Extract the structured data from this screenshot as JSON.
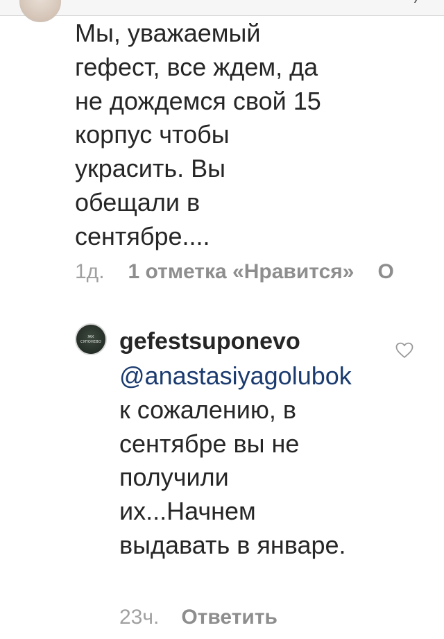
{
  "top_comment": {
    "text": "Мы, уважаемый\nгефест, все ждем, да\nне дождемся свой 15\nкорпус чтобы\nукрасить. Вы\nобещали в\nсентябре....",
    "time": "1д.",
    "likes": "1 отметка «Нравится»",
    "reply_label": "О"
  },
  "reply": {
    "username": "gefestsuponevo",
    "avatar_logo_top": "ЖК",
    "avatar_logo_bottom": "СУПОНЕВО",
    "mention": "@anastasiyagolubok",
    "text": " к сожалению, в сентябре вы не получили их...Начнем выдавать в январе.",
    "time": "23ч.",
    "reply_label": "Ответить"
  },
  "icons": {
    "like": "heart-outline-icon"
  },
  "colors": {
    "text": "#262626",
    "meta": "#8e8e8e",
    "mention": "#1b3b6f"
  }
}
